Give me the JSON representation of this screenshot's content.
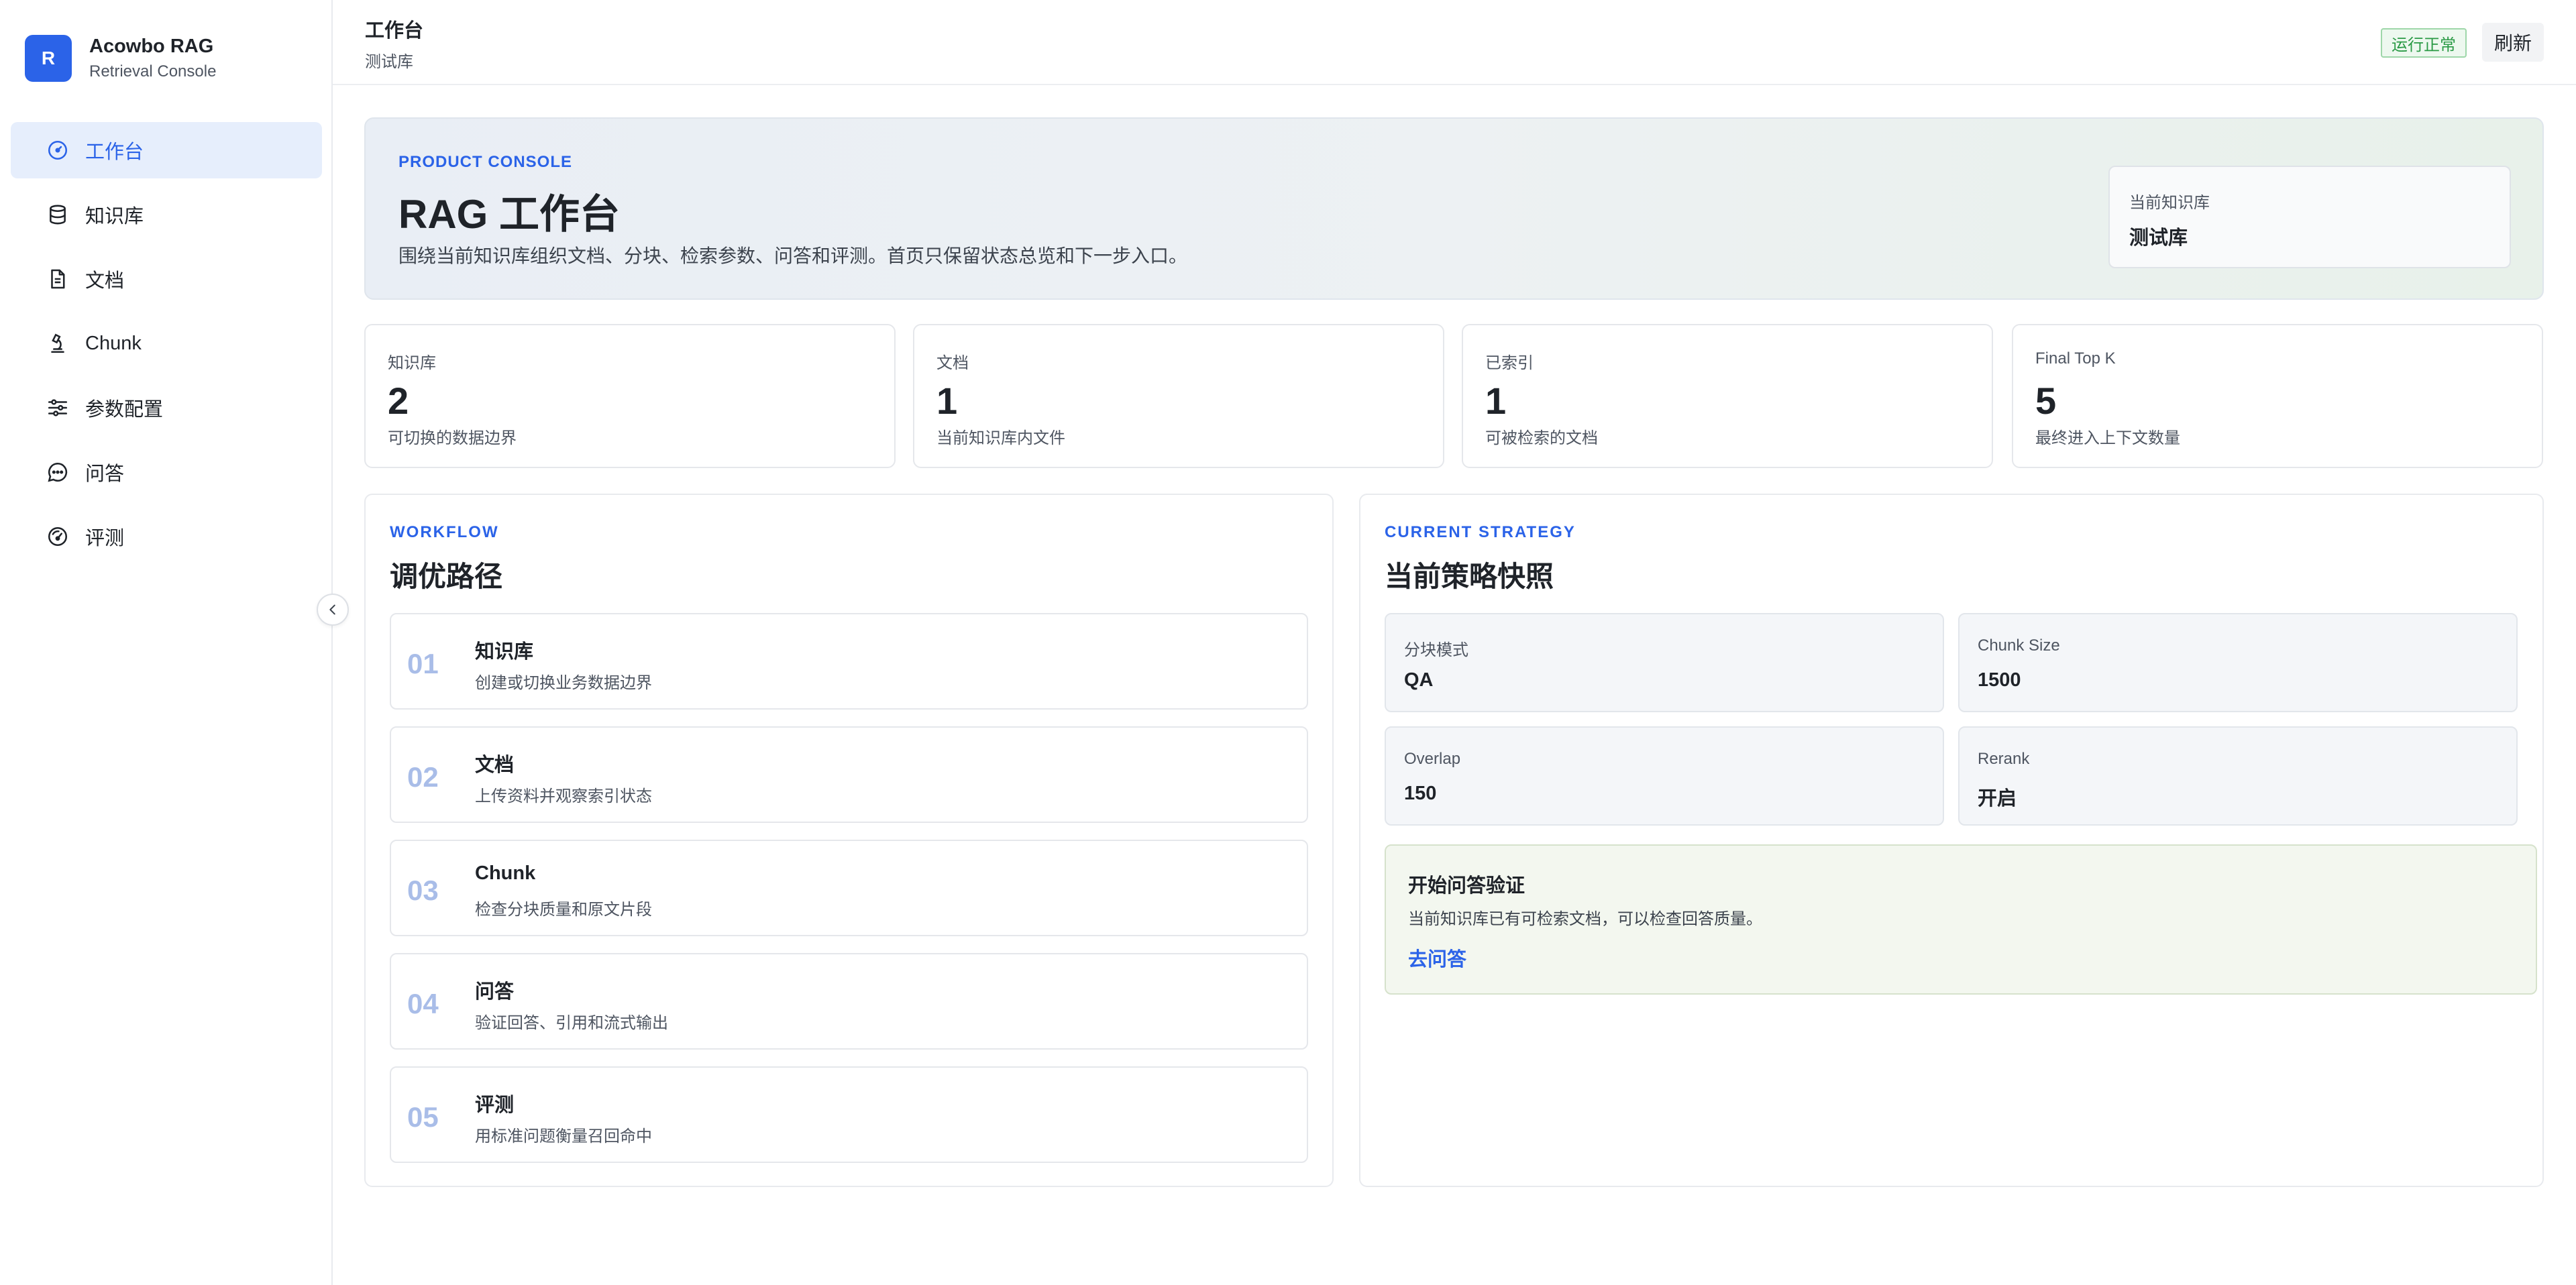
{
  "brand": {
    "logo_letter": "R",
    "name": "Acowbo RAG",
    "subtitle": "Retrieval Console",
    "color": "#2b63e8"
  },
  "sidebar": {
    "items": [
      {
        "label": "工作台",
        "icon": "dashboard-icon",
        "active": true
      },
      {
        "label": "知识库",
        "icon": "database-icon"
      },
      {
        "label": "文档",
        "icon": "document-icon"
      },
      {
        "label": "Chunk",
        "icon": "microscope-icon"
      },
      {
        "label": "参数配置",
        "icon": "sliders-icon"
      },
      {
        "label": "问答",
        "icon": "chat-icon"
      },
      {
        "label": "评测",
        "icon": "gauge-icon"
      }
    ],
    "collapse_icon": "chevron-left-icon"
  },
  "header": {
    "title": "工作台",
    "subtitle": "测试库",
    "status": "运行正常",
    "status_color": "#2a9a45",
    "refresh_label": "刷新"
  },
  "hero": {
    "eyebrow": "PRODUCT CONSOLE",
    "title": "RAG 工作台",
    "description": "围绕当前知识库组织文档、分块、检索参数、问答和评测。首页只保留状态总览和下一步入口。",
    "kb_label": "当前知识库",
    "kb_value": "测试库"
  },
  "stats": [
    {
      "label": "知识库",
      "value": "2",
      "desc": "可切换的数据边界"
    },
    {
      "label": "文档",
      "value": "1",
      "desc": "当前知识库内文件"
    },
    {
      "label": "已索引",
      "value": "1",
      "desc": "可被检索的文档"
    },
    {
      "label": "Final Top K",
      "value": "5",
      "desc": "最终进入上下文数量"
    }
  ],
  "workflow": {
    "eyebrow": "WORKFLOW",
    "title": "调优路径",
    "steps": [
      {
        "num": "01",
        "title": "知识库",
        "desc": "创建或切换业务数据边界"
      },
      {
        "num": "02",
        "title": "文档",
        "desc": "上传资料并观察索引状态"
      },
      {
        "num": "03",
        "title": "Chunk",
        "desc": "检查分块质量和原文片段"
      },
      {
        "num": "04",
        "title": "问答",
        "desc": "验证回答、引用和流式输出"
      },
      {
        "num": "05",
        "title": "评测",
        "desc": "用标准问题衡量召回命中"
      }
    ]
  },
  "strategy": {
    "eyebrow": "CURRENT STRATEGY",
    "title": "当前策略快照",
    "items": [
      {
        "label": "分块模式",
        "value": "QA"
      },
      {
        "label": "Chunk Size",
        "value": "1500"
      },
      {
        "label": "Overlap",
        "value": "150"
      },
      {
        "label": "Rerank",
        "value": "开启"
      }
    ],
    "qa": {
      "title": "开始问答验证",
      "desc": "当前知识库已有可检索文档，可以检查回答质量。",
      "link": "去问答"
    }
  }
}
